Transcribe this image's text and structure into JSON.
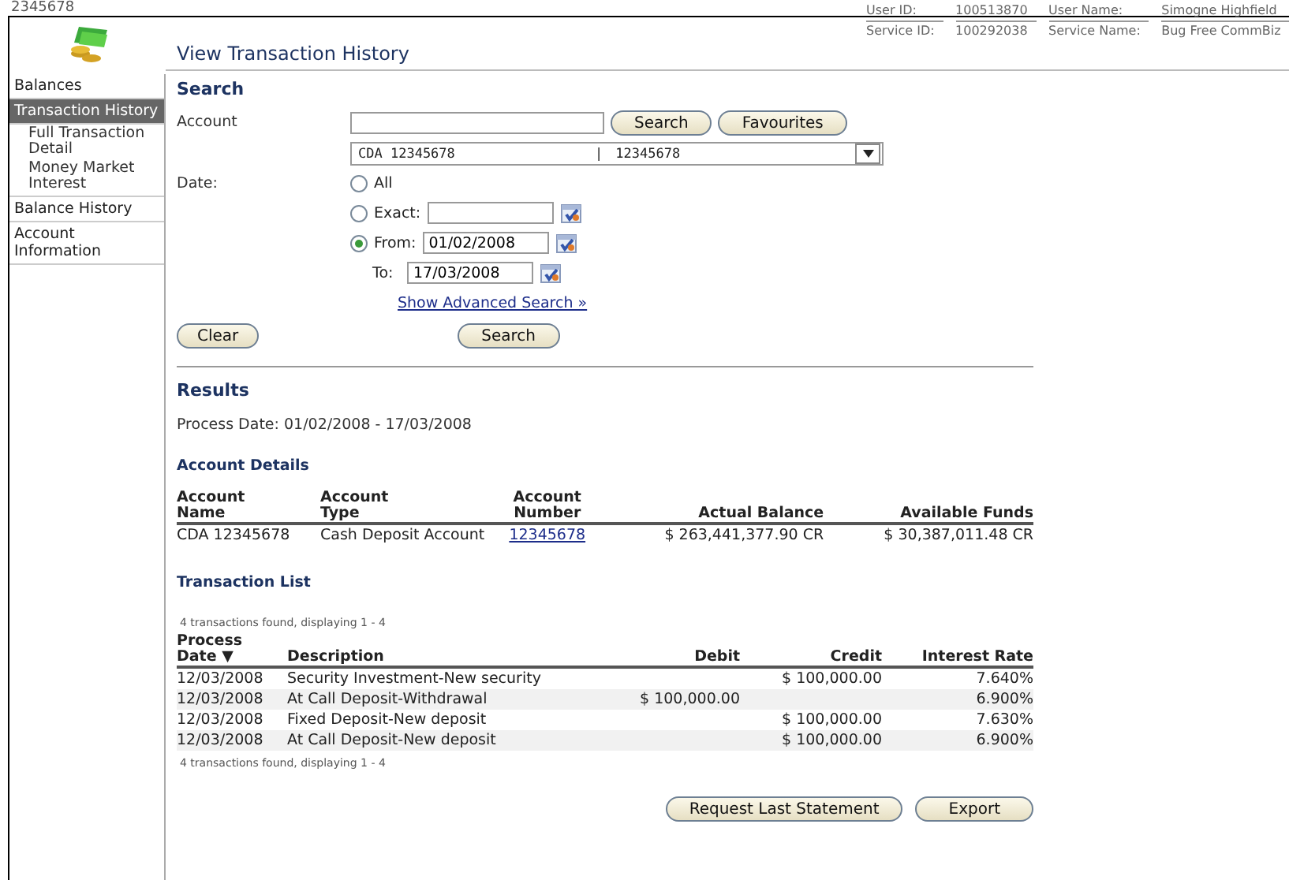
{
  "logo_text": "2345678",
  "header": {
    "title": "View Transaction History",
    "user_info": [
      {
        "label": "User ID:",
        "value": "100513870"
      },
      {
        "label": "User Name:",
        "value": "Simogne Highfield"
      },
      {
        "label": "Service ID:",
        "value": "100292038"
      },
      {
        "label": "Service Name:",
        "value": "Bug Free CommBiz"
      }
    ]
  },
  "sidebar": {
    "items": [
      {
        "label": "Balances",
        "selected": false
      },
      {
        "label": "Transaction History",
        "selected": true,
        "children": [
          {
            "label": "Full Transaction Detail",
            "selected": false
          },
          {
            "label": "Money Market Interest",
            "selected": false
          }
        ]
      },
      {
        "label": "Balance History",
        "selected": false
      },
      {
        "label": "Account Information",
        "selected": false
      }
    ]
  },
  "search": {
    "title": "Search",
    "account_label": "Account",
    "account_buttons": [
      "Search",
      "Favourites"
    ],
    "account_select": {
      "name": "CDA 12345678",
      "separator": "|",
      "number": "12345678"
    },
    "date_label": "Date:",
    "date_options": [
      {
        "label": "All",
        "selected": false,
        "kind": "plain"
      },
      {
        "label": "Exact:",
        "selected": false,
        "kind": "date"
      },
      {
        "label": "From:",
        "selected": true,
        "kind": "date",
        "value": "01/02/2008"
      }
    ],
    "to": {
      "label": "To:",
      "value": "17/03/2008"
    },
    "advanced_link": "Show Advanced Search »",
    "clear_button": "Clear",
    "search_button": "Search"
  },
  "results": {
    "title": "Results",
    "process_date": "Process Date: 01/02/2008 - 17/03/2008",
    "account_details": {
      "title": "Account Details",
      "columns": [
        [
          "Account",
          "Name"
        ],
        [
          "Account",
          "Type"
        ],
        [
          "Account",
          "Number"
        ],
        [
          "Actual Balance"
        ],
        [
          "Available Funds"
        ]
      ],
      "rows": [
        {
          "name": "CDA 12345678",
          "type": "Cash Deposit Account",
          "number": "12345678",
          "actual_balance": "$ 263,441,377.90 CR",
          "available_funds": "$ 30,387,011.48 CR"
        }
      ]
    },
    "transaction_list": {
      "title": "Transaction List",
      "summary_top": "4 transactions found, displaying 1 - 4",
      "columns": [
        [
          "Process",
          "Date ▼"
        ],
        [
          "Description"
        ],
        [
          "Debit"
        ],
        [
          "Credit"
        ],
        [
          "Interest Rate"
        ]
      ],
      "rows": [
        {
          "date": "12/03/2008",
          "description": "Security Investment-New security",
          "credit": "$ 100,000.00",
          "interest_rate": "7.640%"
        },
        {
          "date": "12/03/2008",
          "description": "At Call Deposit-Withdrawal",
          "debit": "$ 100,000.00",
          "interest_rate": "6.900%"
        },
        {
          "date": "12/03/2008",
          "description": "Fixed Deposit-New deposit",
          "credit": "$ 100,000.00",
          "interest_rate": "7.630%"
        },
        {
          "date": "12/03/2008",
          "description": "At Call Deposit-New deposit",
          "credit": "$ 100,000.00",
          "interest_rate": "6.900%"
        }
      ],
      "summary_bottom": "4 transactions found, displaying 1 - 4"
    },
    "buttons": [
      "Request Last Statement",
      "Export"
    ]
  }
}
